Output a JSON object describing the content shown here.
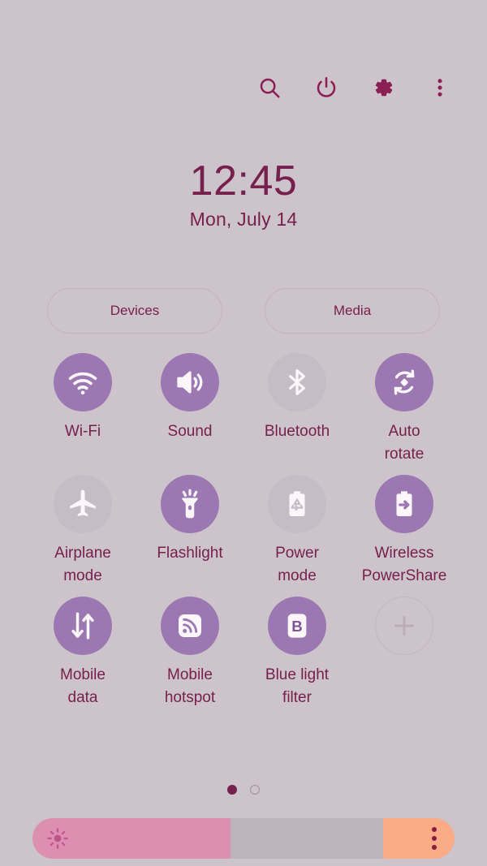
{
  "theme": {
    "background": "#cdc3ca",
    "accent_text": "#76214d",
    "tile_on": "#9c78b2",
    "tile_off": "#c5bcc5",
    "slider_fill": "#dd8fb2",
    "slider_track": "#bcb3bb",
    "slider_end": "#fbab86"
  },
  "topbar": {
    "icons": [
      {
        "name": "search-icon",
        "label": "Search"
      },
      {
        "name": "power-icon",
        "label": "Power off"
      },
      {
        "name": "gear-icon",
        "label": "Settings"
      },
      {
        "name": "more-vertical-icon",
        "label": "More options"
      }
    ]
  },
  "clock": {
    "time": "12:45",
    "date": "Mon, July 14"
  },
  "shortcuts": {
    "devices_label": "Devices",
    "media_label": "Media"
  },
  "tiles": [
    {
      "label": "Wi-Fi",
      "icon": "wifi-icon",
      "state": "on"
    },
    {
      "label": "Sound",
      "icon": "sound-icon",
      "state": "on"
    },
    {
      "label": "Bluetooth",
      "icon": "bluetooth-icon",
      "state": "off"
    },
    {
      "label": "Auto\nrotate",
      "icon": "auto-rotate-icon",
      "state": "on"
    },
    {
      "label": "Airplane\nmode",
      "icon": "airplane-icon",
      "state": "off"
    },
    {
      "label": "Flashlight",
      "icon": "flashlight-icon",
      "state": "on"
    },
    {
      "label": "Power\nmode",
      "icon": "power-mode-icon",
      "state": "off"
    },
    {
      "label": "Wireless\nPowerShare",
      "icon": "wireless-powershare-icon",
      "state": "on"
    },
    {
      "label": "Mobile\ndata",
      "icon": "mobile-data-icon",
      "state": "on"
    },
    {
      "label": "Mobile\nhotspot",
      "icon": "mobile-hotspot-icon",
      "state": "on"
    },
    {
      "label": "Blue light\nfilter",
      "icon": "blue-light-filter-icon",
      "state": "on"
    },
    {
      "label": "",
      "icon": "plus-icon",
      "state": "add"
    }
  ],
  "pager": {
    "pages": 2,
    "current": 1
  },
  "brightness": {
    "value_percent": 47,
    "end_segment_percent": 17,
    "sun_icon": "brightness-sun-icon",
    "menu_icon": "more-vertical-icon"
  }
}
